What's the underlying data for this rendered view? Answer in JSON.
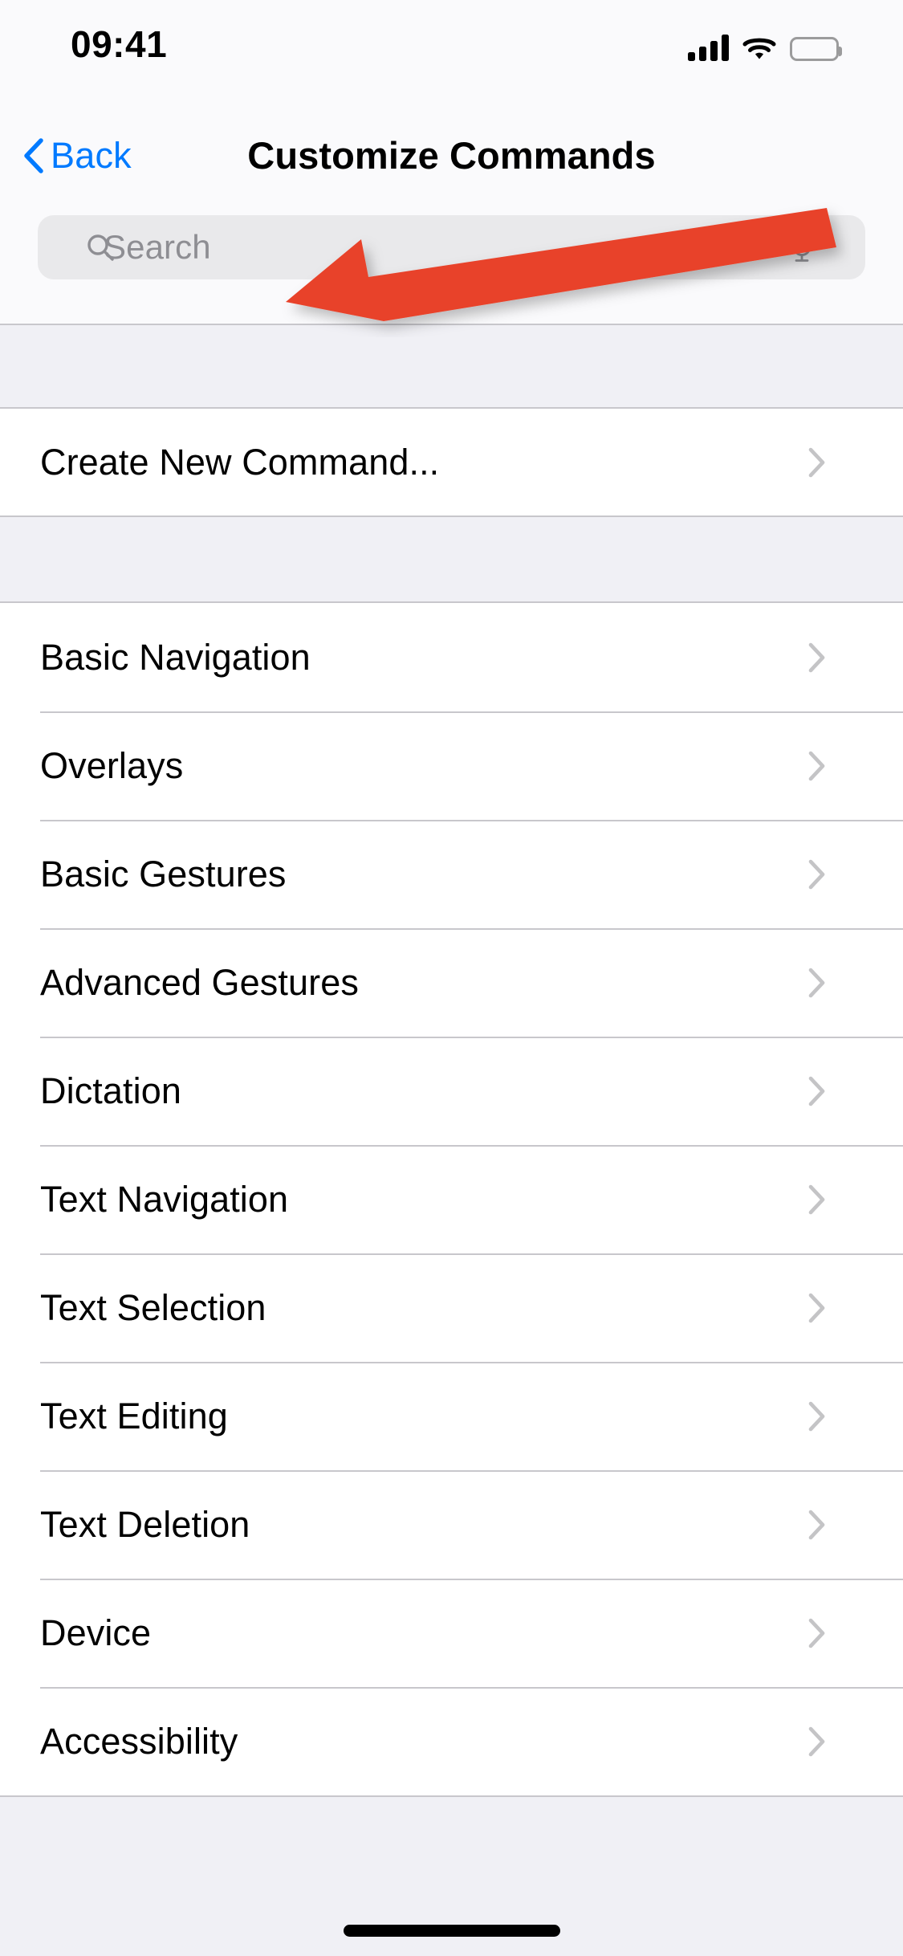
{
  "status_bar": {
    "time": "09:41",
    "signal_icon": "cellular-signal-icon",
    "wifi_icon": "wifi-icon",
    "battery_icon": "battery-full-icon"
  },
  "nav_bar": {
    "back_label": "Back",
    "back_icon": "chevron-left-icon",
    "title": "Customize Commands"
  },
  "search": {
    "placeholder": "Search",
    "value": "",
    "search_icon": "magnifier-icon",
    "mic_icon": "microphone-icon"
  },
  "sections": [
    {
      "name": "create-section",
      "rows": [
        {
          "label": "Create New Command...",
          "accessory": "chevron-right-icon"
        }
      ]
    },
    {
      "name": "categories-section",
      "rows": [
        {
          "label": "Basic Navigation",
          "accessory": "chevron-right-icon"
        },
        {
          "label": "Overlays",
          "accessory": "chevron-right-icon"
        },
        {
          "label": "Basic Gestures",
          "accessory": "chevron-right-icon"
        },
        {
          "label": "Advanced Gestures",
          "accessory": "chevron-right-icon"
        },
        {
          "label": "Dictation",
          "accessory": "chevron-right-icon"
        },
        {
          "label": "Text Navigation",
          "accessory": "chevron-right-icon"
        },
        {
          "label": "Text Selection",
          "accessory": "chevron-right-icon"
        },
        {
          "label": "Text Editing",
          "accessory": "chevron-right-icon"
        },
        {
          "label": "Text Deletion",
          "accessory": "chevron-right-icon"
        },
        {
          "label": "Device",
          "accessory": "chevron-right-icon"
        },
        {
          "label": "Accessibility",
          "accessory": "chevron-right-icon"
        }
      ]
    }
  ],
  "annotation": {
    "arrow_icon": "red-pointer-arrow",
    "color": "#E8432A",
    "points_to": "Create New Command..."
  },
  "home_indicator": "home-indicator-bar",
  "colors": {
    "accent_blue": "#007AFF",
    "annotation_red": "#E8432A",
    "group_background": "#FFFFFF",
    "page_background": "#F0F0F5",
    "search_field": "#E9E9EB",
    "separator": "#C8C7CC",
    "placeholder_gray": "#8E8E93"
  }
}
